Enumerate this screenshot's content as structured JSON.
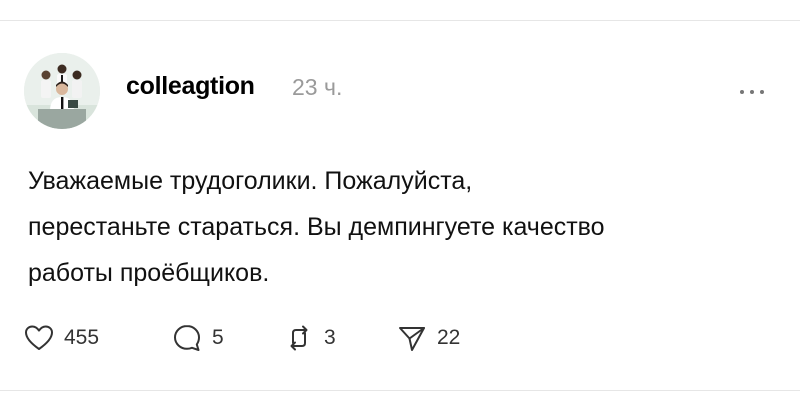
{
  "post": {
    "author": "colleagtion",
    "timestamp": "23 ч.",
    "text": "Уважаемые трудоголики. Пожалуйста,\nперестаньте стараться. Вы демпингуете качество\nработы проёбщиков."
  },
  "actions": {
    "likes": "455",
    "replies": "5",
    "reposts": "3",
    "shares": "22"
  },
  "icons": {
    "more": "ellipsis-icon",
    "like": "heart-icon",
    "reply": "speech-bubble-icon",
    "repost": "repost-arrows-icon",
    "share": "paper-plane-icon"
  },
  "colors": {
    "text": "#111111",
    "muted": "#9a9a9a",
    "divider": "#e6e6e6"
  }
}
